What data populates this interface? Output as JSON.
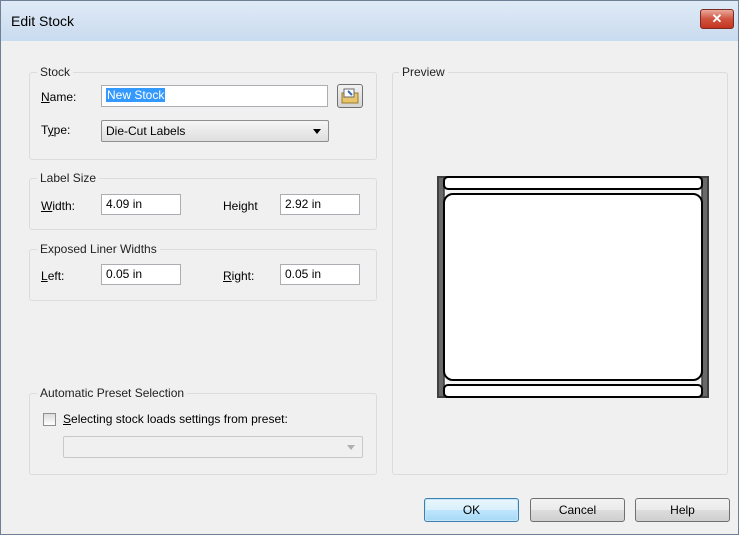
{
  "window": {
    "title": "Edit Stock",
    "close_symbol": "✕"
  },
  "stock": {
    "legend": "Stock",
    "name_label": "Name:",
    "name_value": "New Stock",
    "type_label": "Type:",
    "type_value": "Die-Cut Labels"
  },
  "label_size": {
    "legend": "Label Size",
    "width_label": "Width:",
    "width_value": "4.09 in",
    "height_label": "Height",
    "height_value": "2.92 in"
  },
  "liner": {
    "legend": "Exposed Liner Widths",
    "left_label": "Left:",
    "left_value": "0.05 in",
    "right_label": "Right:",
    "right_value": "0.05 in"
  },
  "preset": {
    "legend": "Automatic Preset Selection",
    "checkbox_label": "Selecting stock loads settings from preset:",
    "checked": false,
    "dropdown_value": ""
  },
  "preview": {
    "legend": "Preview"
  },
  "buttons": {
    "ok": "OK",
    "cancel": "Cancel",
    "help": "Help"
  },
  "icons": {
    "close": "close-icon",
    "browse": "folder-properties-icon"
  }
}
